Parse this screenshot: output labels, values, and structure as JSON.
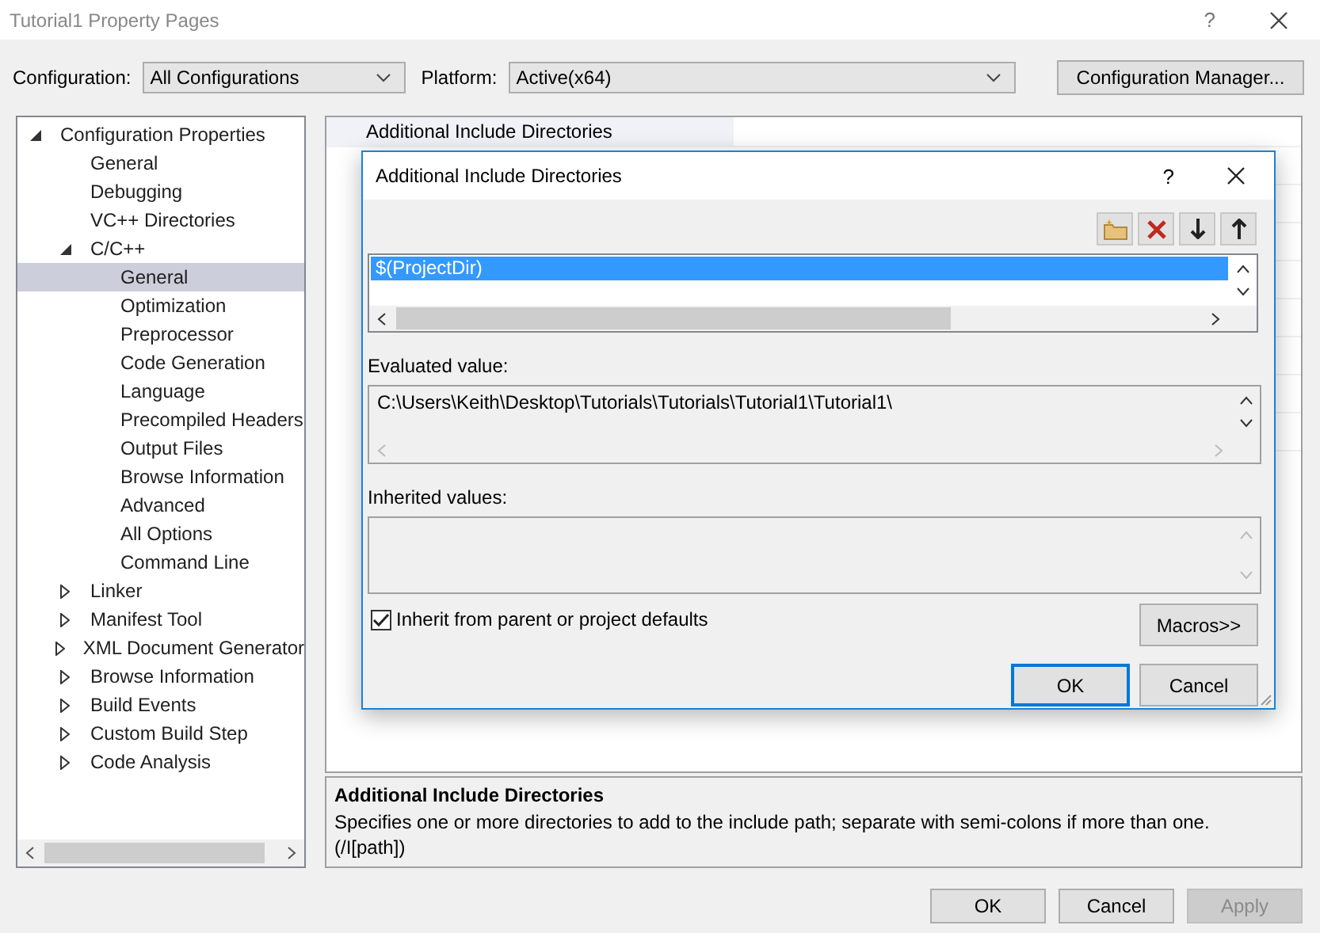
{
  "window": {
    "title": "Tutorial1 Property Pages",
    "help": "?"
  },
  "toolbar": {
    "configuration_label": "Configuration:",
    "configuration_value": "All Configurations",
    "platform_label": "Platform:",
    "platform_value": "Active(x64)",
    "manager_button": "Configuration Manager..."
  },
  "tree": [
    {
      "label": "Configuration Properties",
      "expanded": true,
      "selected": false,
      "children": [
        {
          "label": "General",
          "selected": false
        },
        {
          "label": "Debugging",
          "selected": false
        },
        {
          "label": "VC++ Directories",
          "selected": false
        },
        {
          "label": "C/C++",
          "expanded": true,
          "selected": false,
          "children": [
            {
              "label": "General",
              "selected": true
            },
            {
              "label": "Optimization",
              "selected": false
            },
            {
              "label": "Preprocessor",
              "selected": false
            },
            {
              "label": "Code Generation",
              "selected": false
            },
            {
              "label": "Language",
              "selected": false
            },
            {
              "label": "Precompiled Headers",
              "selected": false
            },
            {
              "label": "Output Files",
              "selected": false
            },
            {
              "label": "Browse Information",
              "selected": false
            },
            {
              "label": "Advanced",
              "selected": false
            },
            {
              "label": "All Options",
              "selected": false
            },
            {
              "label": "Command Line",
              "selected": false
            }
          ]
        },
        {
          "label": "Linker",
          "expanded": false,
          "selected": false
        },
        {
          "label": "Manifest Tool",
          "expanded": false,
          "selected": false
        },
        {
          "label": "XML Document Generator",
          "expanded": false,
          "selected": false
        },
        {
          "label": "Browse Information",
          "expanded": false,
          "selected": false
        },
        {
          "label": "Build Events",
          "expanded": false,
          "selected": false
        },
        {
          "label": "Custom Build Step",
          "expanded": false,
          "selected": false
        },
        {
          "label": "Code Analysis",
          "expanded": false,
          "selected": false
        }
      ]
    }
  ],
  "grid": {
    "rows": [
      {
        "name": "Additional Include Directories",
        "selected": true
      }
    ]
  },
  "description": {
    "title": "Additional Include Directories",
    "text": "Specifies one or more directories to add to the include path; separate with semi-colons if more than one.",
    "switch": "(/I[path])"
  },
  "dialog": {
    "title": "Additional Include Directories",
    "help": "?",
    "entries": [
      {
        "text": "$(ProjectDir)",
        "selected": true
      }
    ],
    "evaluated_label": "Evaluated value:",
    "evaluated_value": "C:\\Users\\Keith\\Desktop\\Tutorials\\Tutorials\\Tutorial1\\Tutorial1\\",
    "inherited_label": "Inherited values:",
    "inherit_checkbox": {
      "label": "Inherit from parent or project defaults",
      "checked": true
    },
    "macros_button": "Macros>>",
    "buttons": [
      {
        "label": "OK",
        "default": true
      },
      {
        "label": "Cancel",
        "default": false
      }
    ]
  },
  "buttons": [
    {
      "label": "OK",
      "disabled": false
    },
    {
      "label": "Cancel",
      "disabled": false
    },
    {
      "label": "Apply",
      "disabled": true
    }
  ]
}
